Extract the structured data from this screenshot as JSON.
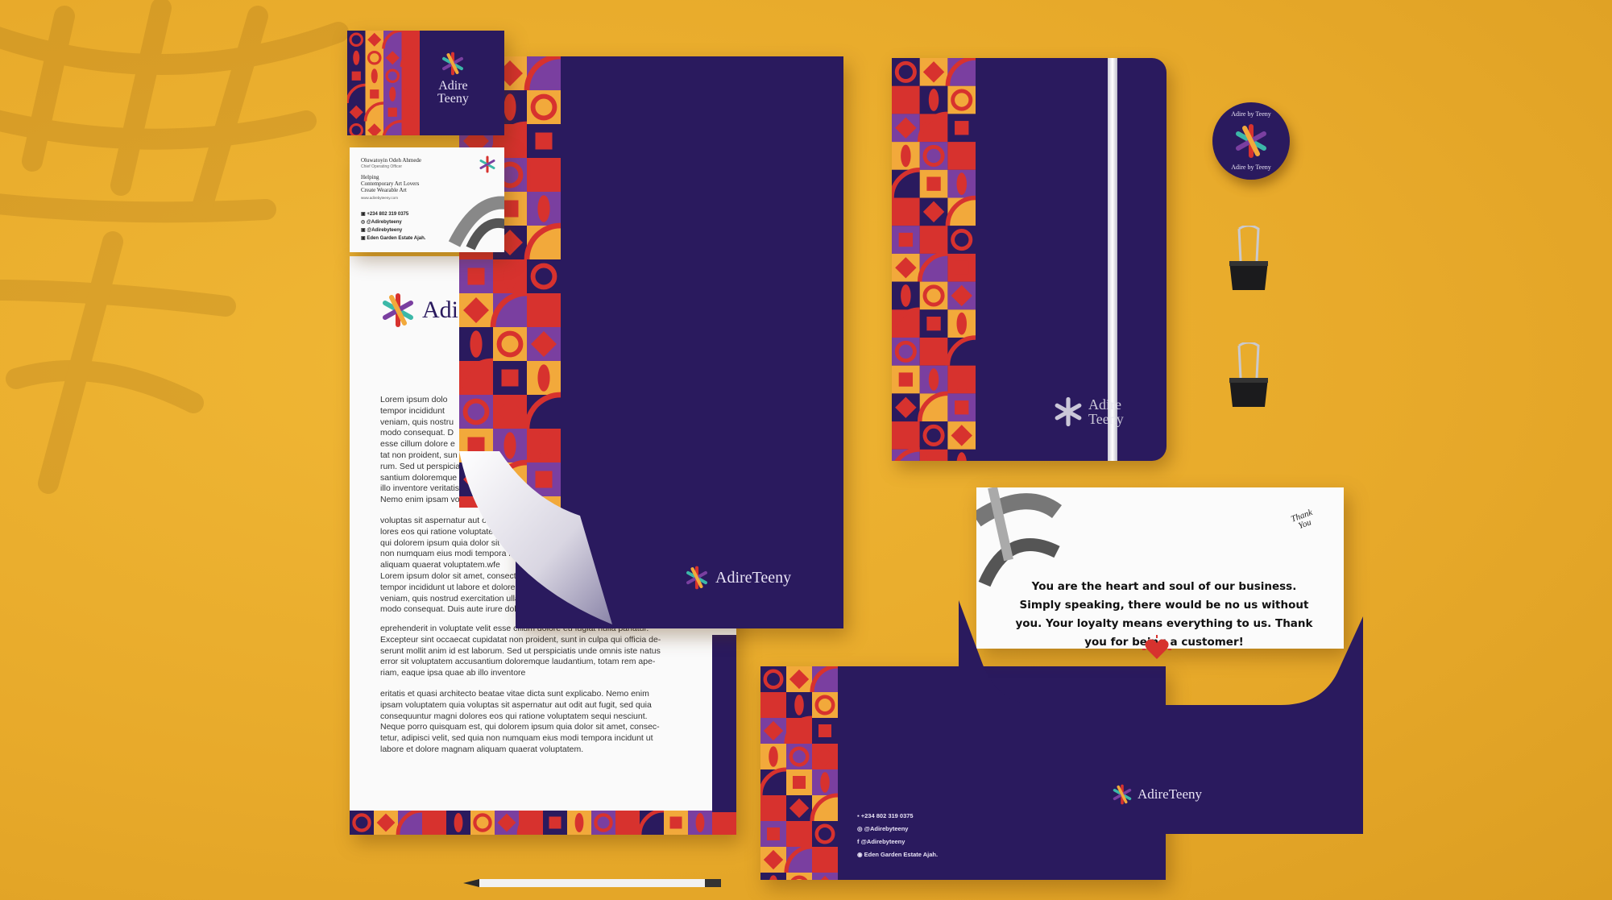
{
  "brand": {
    "name": "AdireTeeny",
    "card_logo_line1": "Adire",
    "card_logo_line2": "Teeny",
    "letterhead_logo": "Adi",
    "colors": {
      "navy": "#2a1a5e",
      "yellow": "#e9ad2c",
      "teal": "#3cb8a8",
      "red": "#d7322e",
      "purple": "#7a3fa0",
      "orange": "#f2a93b"
    }
  },
  "business_card": {
    "name": "Oluwatoyin Odeh Ahmede",
    "subtitle": "Chief Operating Officer",
    "tagline": "Helping\nContemporary Art Lovers\nCreate Wearable Art",
    "small_url": "www.adirebyteeny.com",
    "phone": "+234 802 319 0375",
    "instagram": "@Adirebyteeny",
    "facebook": "@Adirebyteeny",
    "address": "Eden Garden Estate Ajah."
  },
  "badge": {
    "top_text": "Adire by Teeny",
    "bottom_text": "Adire by Teeny"
  },
  "letterhead": {
    "para1": "Lorem ipsum dolo\ntempor incididunt\nveniam, quis nostru\nmodo consequat. D\nesse cillum dolore e\ntat non proident, sun\nrum. Sed ut perspiciati\nsantium doloremque laud\nillo inventore veritatis et qua\nNemo enim ipsam voluptatem",
    "para2": "voluptas sit aspernatur aut odit au\nlores eos qui ratione voluptatem seq\nqui dolorem ipsum quia dolor sit am\nnon numquam eius modi tempora inc\naliquam quaerat voluptatem.wfe\nLorem ipsum dolor sit amet, consectetur a\ntempor incididunt ut labore et dolore mag\nveniam, quis nostrud exercitation ullamco labo\nmodo consequat. Duis aute irure dolor in r",
    "para3": "eprehenderit in voluptate velit esse cillum dolore eu fugiat nulla pariatur.\nExcepteur sint occaecat cupidatat non proident, sunt in culpa qui officia de-\nserunt mollit anim id est laborum. Sed ut perspiciatis unde omnis iste natus\nerror sit voluptatem accusantium doloremque laudantium, totam rem ape-\nriam, eaque ipsa quae ab illo inventore",
    "para4": "eritatis et quasi architecto beatae vitae dicta sunt explicabo. Nemo enim\nipsam voluptatem quia voluptas sit aspernatur aut odit aut fugit, sed quia\nconsequuntur magni dolores eos qui ratione voluptatem sequi nesciunt.\nNeque porro quisquam est, qui dolorem ipsum quia dolor sit amet, consec-\ntetur, adipisci velit, sed quia non numquam eius modi tempora incidunt ut\nlabore et dolore magnam aliquam quaerat voluptatem."
  },
  "thank_you_card": {
    "stamp": "Thank\nYou",
    "message": "You are the heart and soul of our business. Simply speaking, there would be no us without you. Your loyalty means everything to us. Thank you for being a customer!"
  },
  "small_envelope": {
    "phone": "+234 802 319 0375",
    "instagram": "@Adirebyteeny",
    "facebook": "@Adirebyteeny",
    "address": "Eden Garden Estate Ajah."
  }
}
